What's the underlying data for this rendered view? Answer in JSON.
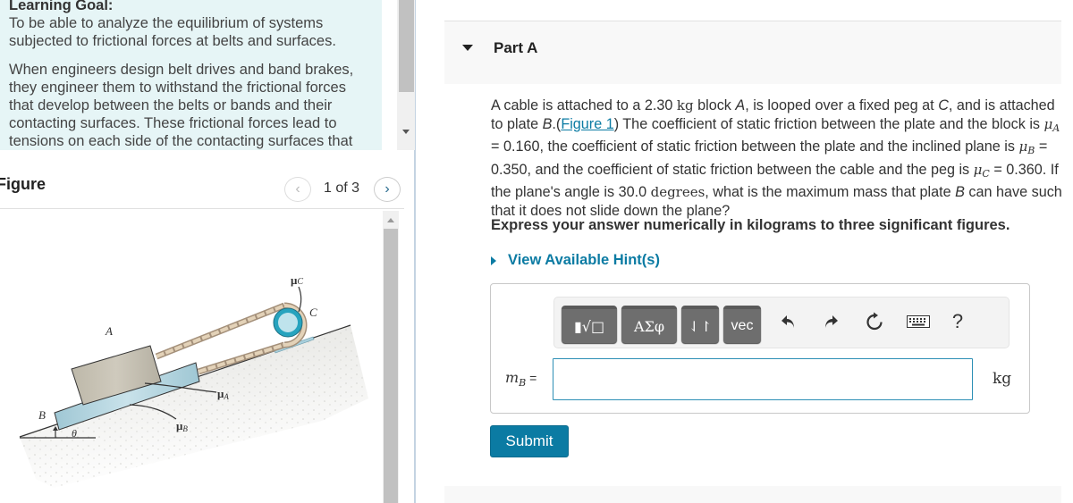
{
  "learning_goal": {
    "title": "Learning Goal:",
    "text": "To be able to analyze the equilibrium of systems subjected to frictional forces at belts and surfaces.",
    "intro": "When engineers design belt drives and band brakes, they engineer them to withstand the frictional forces that develop between the belts or bands and their contacting surfaces. These frictional forces lead to tensions on each side of the contacting surfaces that"
  },
  "figure": {
    "title": "Figure",
    "counter": "1 of 3",
    "prev_icon": "chevron-left-icon",
    "next_icon": "chevron-right-icon",
    "labels": {
      "A": "A",
      "B": "B",
      "C": "C",
      "mu_A": "μA",
      "mu_B": "μB",
      "mu_C": "μC",
      "theta": "θ"
    }
  },
  "part": {
    "title": "Part A",
    "question": {
      "t1": "A cable is attached to a 2.30 ",
      "unit_kg": "kg",
      "t2": " block ",
      "A": "A",
      "t3": ", is looped over a fixed peg at ",
      "C": "C",
      "t4": ", and is attached to plate ",
      "B": "B",
      "t5": ".(",
      "figure_link": "Figure 1",
      "t6": ") The coefficient of static friction between the plate and the block is ",
      "muA_sym": "μ",
      "muA_sub": "A",
      "t7": " = 0.160, the coefficient of static friction between the plate and the inclined plane is ",
      "muB_sym": "μ",
      "muB_sub": "B",
      "t8": " = 0.350, and the coefficient of static friction between the cable and the peg is ",
      "muC_sym": "μ",
      "muC_sub": "C",
      "t9": " = 0.360. If the plane's angle is 30.0 ",
      "unit_deg": "degrees",
      "t10": ", what is the maximum mass that plate ",
      "B2": "B",
      "t11": " can have such that it does not slide down the plane?"
    },
    "instructions": "Express your answer numerically in kilograms to three significant figures.",
    "hints_label": "View Available Hint(s)",
    "toolbar": {
      "templates": "▮√□",
      "greek": "ΑΣφ",
      "arrows": "⇃↾",
      "vec": "vec",
      "undo": "undo-icon",
      "redo": "redo-icon",
      "reset": "reset-icon",
      "keyboard": "keyboard-icon",
      "help": "?"
    },
    "answer": {
      "var": "m",
      "var_sub": "B",
      "eq": " =",
      "value": "",
      "placeholder": "",
      "unit": "kg"
    },
    "submit_label": "Submit"
  },
  "colors": {
    "accent": "#0b7ba3",
    "goal_bg": "#e6f5f6",
    "toolbar_btn": "#6e6e6e"
  }
}
